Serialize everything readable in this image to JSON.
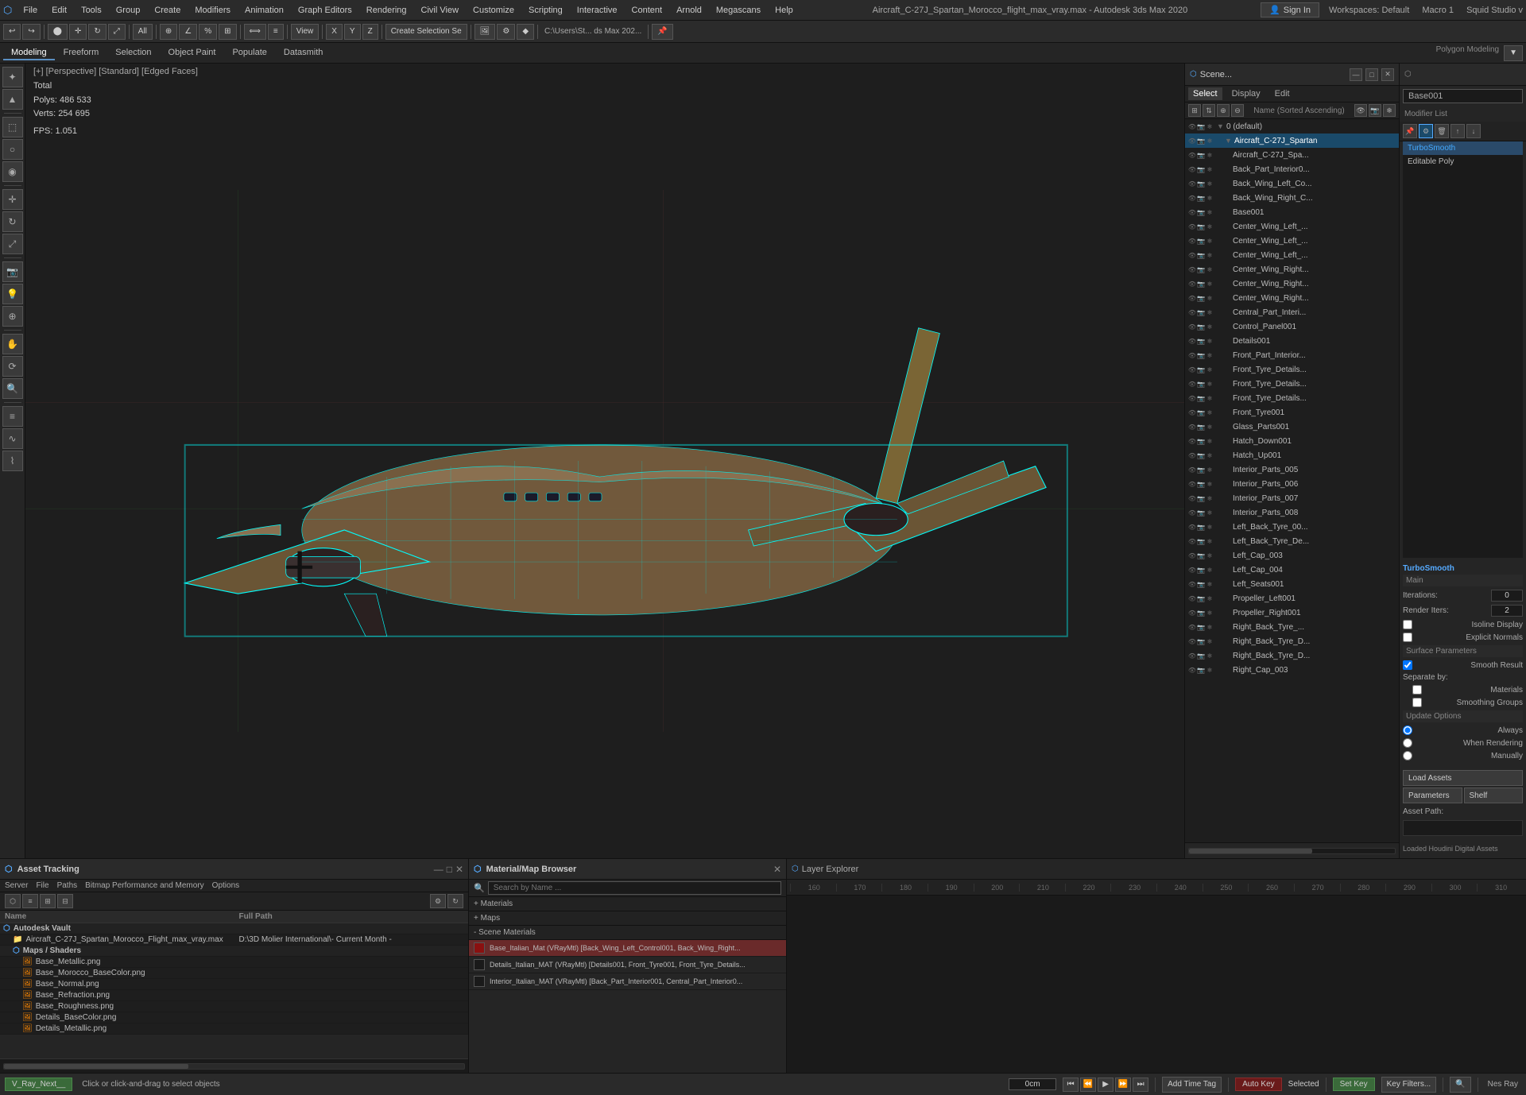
{
  "title": "Aircraft_C-27J_Spartan_Morocco_flight_max_vray.max - Autodesk 3ds Max 2020",
  "menu": {
    "items": [
      "File",
      "Edit",
      "Tools",
      "Group",
      "Create",
      "Modifiers",
      "Animation",
      "Graph Editors",
      "Rendering",
      "Civil View",
      "Customize",
      "Scripting",
      "Interactive",
      "Content",
      "Arnold",
      "Megascans",
      "Help"
    ]
  },
  "sign_in": "Sign In",
  "workspaces": "Workspaces: Default",
  "macro": "Macro 1",
  "squid": "Squid Studio v",
  "toolbar1": {
    "mode_label": "All",
    "view_label": "View",
    "selection_label": "Create Selection Se"
  },
  "sub_tabs": [
    "Modeling",
    "Freeform",
    "Selection",
    "Object Paint",
    "Populate",
    "Datasmith"
  ],
  "sub_tab_active": "Modeling",
  "viewport": {
    "label": "[+] [Perspective] [Standard] [Edged Faces]",
    "stats": {
      "total_label": "Total",
      "polys_label": "Polys:",
      "polys_value": "486 533",
      "verts_label": "Verts:",
      "verts_value": "254 695",
      "fps_label": "FPS:",
      "fps_value": "1.051"
    }
  },
  "scene_explorer": {
    "title": "Scene...",
    "tabs": [
      "Select",
      "Display",
      "Edit"
    ],
    "active_tab": "Select",
    "header_label": "Name (Sorted Ascending)",
    "items": [
      {
        "name": "0 (default)",
        "indent": 0,
        "selected": false,
        "eye": true
      },
      {
        "name": "Aircraft_C-27J_Spartan",
        "indent": 1,
        "selected": true,
        "eye": true
      },
      {
        "name": "Aircraft_C-27J_Spa...",
        "indent": 2,
        "selected": false,
        "eye": true
      },
      {
        "name": "Back_Part_Interior0...",
        "indent": 2,
        "selected": false,
        "eye": true
      },
      {
        "name": "Back_Wing_Left_Co...",
        "indent": 2,
        "selected": false,
        "eye": true
      },
      {
        "name": "Back_Wing_Right_C...",
        "indent": 2,
        "selected": false,
        "eye": true
      },
      {
        "name": "Base001",
        "indent": 2,
        "selected": false,
        "eye": true
      },
      {
        "name": "Center_Wing_Left_...",
        "indent": 2,
        "selected": false,
        "eye": true
      },
      {
        "name": "Center_Wing_Left_...",
        "indent": 2,
        "selected": false,
        "eye": true
      },
      {
        "name": "Center_Wing_Left_...",
        "indent": 2,
        "selected": false,
        "eye": true
      },
      {
        "name": "Center_Wing_Right...",
        "indent": 2,
        "selected": false,
        "eye": true
      },
      {
        "name": "Center_Wing_Right...",
        "indent": 2,
        "selected": false,
        "eye": true
      },
      {
        "name": "Center_Wing_Right...",
        "indent": 2,
        "selected": false,
        "eye": true
      },
      {
        "name": "Central_Part_Interi...",
        "indent": 2,
        "selected": false,
        "eye": true
      },
      {
        "name": "Control_Panel001",
        "indent": 2,
        "selected": false,
        "eye": true
      },
      {
        "name": "Details001",
        "indent": 2,
        "selected": false,
        "eye": true
      },
      {
        "name": "Front_Part_Interior...",
        "indent": 2,
        "selected": false,
        "eye": true
      },
      {
        "name": "Front_Tyre_Details...",
        "indent": 2,
        "selected": false,
        "eye": true
      },
      {
        "name": "Front_Tyre_Details...",
        "indent": 2,
        "selected": false,
        "eye": true
      },
      {
        "name": "Front_Tyre_Details...",
        "indent": 2,
        "selected": false,
        "eye": true
      },
      {
        "name": "Front_Tyre001",
        "indent": 2,
        "selected": false,
        "eye": true
      },
      {
        "name": "Glass_Parts001",
        "indent": 2,
        "selected": false,
        "eye": true
      },
      {
        "name": "Hatch_Down001",
        "indent": 2,
        "selected": false,
        "eye": true
      },
      {
        "name": "Hatch_Up001",
        "indent": 2,
        "selected": false,
        "eye": true
      },
      {
        "name": "Interior_Parts_005",
        "indent": 2,
        "selected": false,
        "eye": true
      },
      {
        "name": "Interior_Parts_006",
        "indent": 2,
        "selected": false,
        "eye": true
      },
      {
        "name": "Interior_Parts_007",
        "indent": 2,
        "selected": false,
        "eye": true
      },
      {
        "name": "Interior_Parts_008",
        "indent": 2,
        "selected": false,
        "eye": true
      },
      {
        "name": "Left_Back_Tyre_00...",
        "indent": 2,
        "selected": false,
        "eye": true
      },
      {
        "name": "Left_Back_Tyre_De...",
        "indent": 2,
        "selected": false,
        "eye": true
      },
      {
        "name": "Left_Cap_003",
        "indent": 2,
        "selected": false,
        "eye": true
      },
      {
        "name": "Left_Cap_004",
        "indent": 2,
        "selected": false,
        "eye": true
      },
      {
        "name": "Left_Seats001",
        "indent": 2,
        "selected": false,
        "eye": true
      },
      {
        "name": "Propeller_Left001",
        "indent": 2,
        "selected": false,
        "eye": true
      },
      {
        "name": "Propeller_Right001",
        "indent": 2,
        "selected": false,
        "eye": true
      },
      {
        "name": "Right_Back_Tyre_...",
        "indent": 2,
        "selected": false,
        "eye": true
      },
      {
        "name": "Right_Back_Tyre_D...",
        "indent": 2,
        "selected": false,
        "eye": true
      },
      {
        "name": "Right_Back_Tyre_D...",
        "indent": 2,
        "selected": false,
        "eye": true
      },
      {
        "name": "Right_Cap_003",
        "indent": 2,
        "selected": false,
        "eye": true
      }
    ]
  },
  "modifier_panel": {
    "object_name": "Base001",
    "list_label": "Modifier List",
    "modifiers": [
      {
        "name": "TurboSmooth",
        "active": true
      },
      {
        "name": "Editable Poly",
        "active": false
      }
    ],
    "turbosmooth": {
      "section": "TurboSmooth",
      "main_label": "Main",
      "iterations_label": "Iterations:",
      "iterations_value": "0",
      "render_iters_label": "Render Iters:",
      "render_iters_value": "2",
      "isoline_label": "Isoline Display",
      "explicit_label": "Explicit Normals",
      "surface_label": "Surface Parameters",
      "smooth_label": "Smooth Result",
      "separate_label": "Separate by:",
      "materials_label": "Materials",
      "smoothing_label": "Smoothing Groups",
      "update_label": "Update Options",
      "always_label": "Always",
      "when_render_label": "When Rendering",
      "manually_label": "Manually"
    },
    "load_assets_label": "Load Assets",
    "parameters_label": "Parameters",
    "shelf_label": "Shelf",
    "asset_path_label": "Asset Path:",
    "houdini_label": "Loaded Houdini Digital Assets"
  },
  "asset_tracking": {
    "title": "Asset Tracking",
    "menu_items": [
      "Server",
      "File",
      "Paths",
      "Bitmap Performance and Memory",
      "Options"
    ],
    "columns": [
      "Name",
      "Full Path"
    ],
    "rows": [
      {
        "type": "group",
        "name": "Autodesk Vault",
        "path": "",
        "indent": 0
      },
      {
        "type": "file",
        "name": "Aircraft_C-27J_Spartan_Morocco_Flight_max_vray.max",
        "path": "D:\\3D Molier International\\- Current Month -",
        "indent": 1
      },
      {
        "type": "group",
        "name": "Maps / Shaders",
        "path": "",
        "indent": 1
      },
      {
        "type": "map",
        "name": "Base_Metallic.png",
        "path": "",
        "indent": 2
      },
      {
        "type": "map",
        "name": "Base_Morocco_BaseColor.png",
        "path": "",
        "indent": 2
      },
      {
        "type": "map",
        "name": "Base_Normal.png",
        "path": "",
        "indent": 2
      },
      {
        "type": "map",
        "name": "Base_Refraction.png",
        "path": "",
        "indent": 2
      },
      {
        "type": "map",
        "name": "Base_Roughness.png",
        "path": "",
        "indent": 2
      },
      {
        "type": "map",
        "name": "Details_BaseColor.png",
        "path": "",
        "indent": 2
      },
      {
        "type": "map",
        "name": "Details_Metallic.png",
        "path": "",
        "indent": 2
      }
    ]
  },
  "material_browser": {
    "title": "Material/Map Browser",
    "search_placeholder": "Search by Name ...",
    "sections": [
      {
        "label": "+ Materials",
        "expanded": false
      },
      {
        "label": "+ Maps",
        "expanded": false
      },
      {
        "label": "- Scene Materials",
        "expanded": true
      }
    ],
    "scene_materials": [
      {
        "name": "Base_Italian_Mat (VRayMtl) [Back_Wing_Left_Control001, Back_Wing_Right...",
        "color": "#8a1010",
        "highlight": true
      },
      {
        "name": "Details_Italian_MAT (VRayMtl) [Details001, Front_Tyre001, Front_Tyre_Details...",
        "color": "#1a1a1a",
        "highlight": false
      },
      {
        "name": "Interior_Italian_MAT (VRayMtl) [Back_Part_Interior001, Central_Part_Interior0...",
        "color": "#1a1a1a",
        "highlight": false
      }
    ]
  },
  "timeline": {
    "layer_explorer_label": "Layer Explorer",
    "rulers": [
      "160",
      "170",
      "180",
      "190",
      "200",
      "210",
      "220",
      "230",
      "240",
      "250",
      "260",
      "270",
      "280",
      "290",
      "300",
      "310"
    ]
  },
  "status_bar": {
    "vray_label": "V_Ray_Next__",
    "hint": "Click or click-and-drag to select objects",
    "time_field": "0cm",
    "add_time_tag": "Add Time Tag",
    "auto_key_label": "Auto Key",
    "selected_label": "Selected",
    "set_key_label": "Set Key",
    "key_filters_label": "Key Filters...",
    "nes_ray_label": "Nes Ray"
  },
  "playback": {
    "buttons": [
      "⏮",
      "⏪",
      "▶",
      "⏩",
      "⏭"
    ]
  }
}
